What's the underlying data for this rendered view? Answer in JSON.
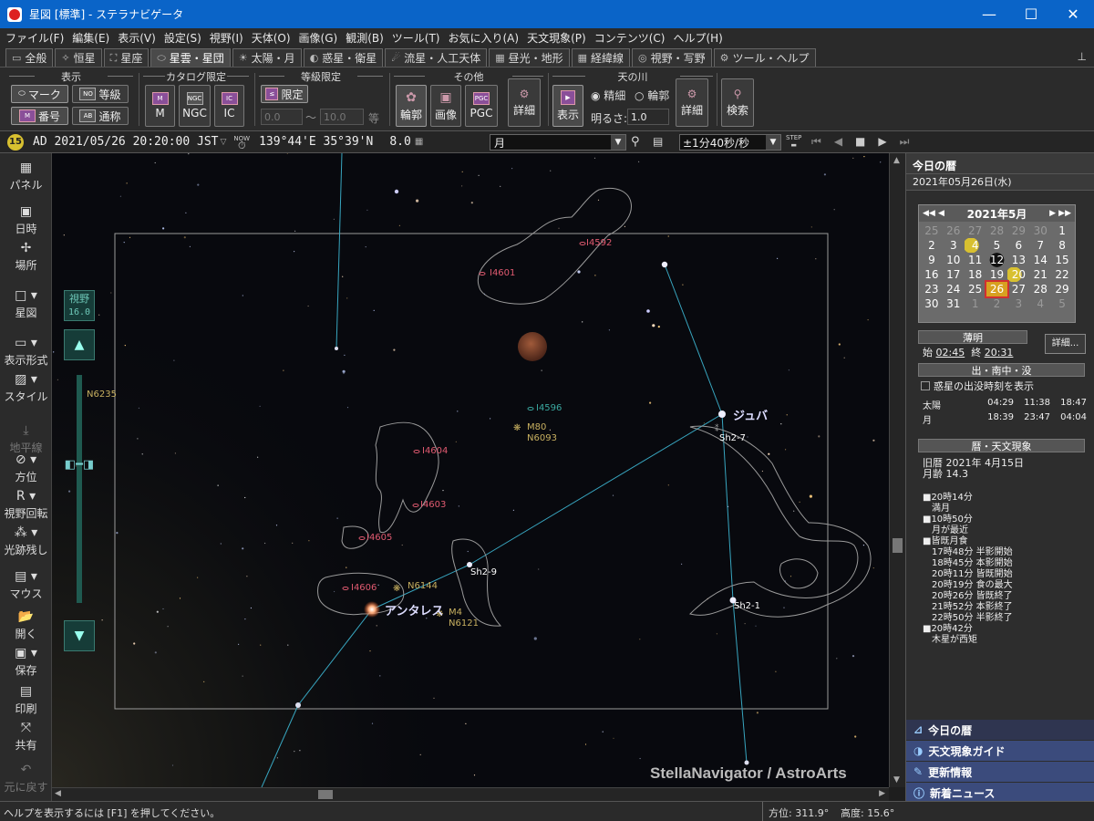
{
  "window": {
    "title": "星図 [標準] - ステラナビゲータ",
    "minimize": "—",
    "maximize": "☐",
    "close": "✕"
  },
  "menu": [
    "ファイル(F)",
    "編集(E)",
    "表示(V)",
    "設定(S)",
    "視野(I)",
    "天体(O)",
    "画像(G)",
    "観測(B)",
    "ツール(T)",
    "お気に入り(A)",
    "天文現象(P)",
    "コンテンツ(C)",
    "ヘルプ(H)"
  ],
  "tabs": [
    {
      "label": "全般",
      "icon": "▭"
    },
    {
      "label": "恒星",
      "icon": "✧"
    },
    {
      "label": "星座",
      "icon": "⛶"
    },
    {
      "label": "星雲・星団",
      "icon": "⬭",
      "active": true
    },
    {
      "label": "太陽・月",
      "icon": "☀"
    },
    {
      "label": "惑星・衛星",
      "icon": "◐"
    },
    {
      "label": "流星・人工天体",
      "icon": "☄"
    },
    {
      "label": "昼光・地形",
      "icon": "▦"
    },
    {
      "label": "経緯線",
      "icon": "▦"
    },
    {
      "label": "視野・写野",
      "icon": "◎"
    },
    {
      "label": "ツール・ヘルプ",
      "icon": "⚙"
    }
  ],
  "ribbon": {
    "display": {
      "title": "表示",
      "mark": "マーク",
      "rank": "等級",
      "number": "番号",
      "common": "通称"
    },
    "catalog": {
      "title": "カタログ限定",
      "m": "M",
      "ngc": "NGC",
      "ic": "IC",
      "m_icon": "M",
      "ngc_icon": "NGC",
      "ic_icon": "IC"
    },
    "mag": {
      "title": "等級限定",
      "limit": "限定",
      "from": "0.0",
      "to": "10.0",
      "sep": "〜",
      "unit": "等"
    },
    "other": {
      "title": "その他",
      "outline": "輪郭",
      "image": "画像",
      "pgc": "PGC",
      "pgc_icon": "PGC",
      "detail": "詳細"
    },
    "milkyway": {
      "title": "天の川",
      "show": "表示",
      "fine": "精細",
      "contour": "輪郭",
      "brightness_label": "明るさ:",
      "brightness": "1.0",
      "detail": "詳細"
    },
    "search": "検索"
  },
  "status": {
    "moon_age_badge": "15",
    "datetime": "AD 2021/05/26 20:20:00 JST",
    "now": "NOW",
    "location": "139°44'E 35°39'N",
    "zoom": "8.0",
    "target": "月",
    "step": "±1分40秒/秒",
    "step_label": "STEP"
  },
  "left_tools": [
    {
      "label": "パネル",
      "icon": "▦"
    },
    {
      "label": "日時",
      "icon": "▣"
    },
    {
      "label": "場所",
      "icon": "✢"
    },
    {
      "label": "星図",
      "icon": "□ ▾"
    },
    {
      "label": "表示形式",
      "icon": "▭ ▾"
    },
    {
      "label": "スタイル",
      "icon": "▨ ▾"
    },
    {
      "label": "地平線",
      "icon": "⤓"
    },
    {
      "label": "方位",
      "icon": "⊘ ▾"
    },
    {
      "label": "視野回転",
      "icon": "R ▾"
    },
    {
      "label": "光跡残し",
      "icon": "⁂ ▾"
    },
    {
      "label": "マウス",
      "icon": "▤ ▾"
    },
    {
      "label": "開く",
      "icon": "📂"
    },
    {
      "label": "保存",
      "icon": "▣ ▾"
    },
    {
      "label": "印刷",
      "icon": "▤"
    },
    {
      "label": "共有",
      "icon": "⤧"
    },
    {
      "label": "元に戻す",
      "icon": "↶"
    }
  ],
  "fov": {
    "label": "視野",
    "value": "16.0",
    "up": "▲",
    "down": "▼"
  },
  "sky": {
    "objects": [
      {
        "id": "jupiter",
        "name": "ジュバ",
        "code": "Sh2-7"
      },
      {
        "id": "antares",
        "name": "アンタレス"
      },
      {
        "id": "m80",
        "name": "M80",
        "code": "N6093"
      },
      {
        "id": "m4",
        "name": "M4",
        "code": "N6121"
      },
      {
        "id": "n6144",
        "name": "N6144"
      },
      {
        "id": "i4596",
        "name": "I4596"
      },
      {
        "id": "i4592",
        "name": "I4592"
      },
      {
        "id": "i4601",
        "name": "I4601"
      },
      {
        "id": "i4604",
        "name": "I4604"
      },
      {
        "id": "i4603",
        "name": "I4603"
      },
      {
        "id": "i4605",
        "name": "I4605"
      },
      {
        "id": "i4606",
        "name": "I4606"
      },
      {
        "id": "sh29",
        "name": "Sh2-9"
      },
      {
        "id": "sh21",
        "name": "Sh2-1"
      },
      {
        "id": "n6235",
        "name": "N6235"
      }
    ],
    "watermark": "StellaNavigator / AstroArts"
  },
  "right": {
    "header": "今日の暦",
    "date": "2021年05月26日(水)",
    "calendar": {
      "title": "2021年5月",
      "prev": "◀◀ ◀",
      "next": "▶ ▶▶",
      "days": [
        [
          "25",
          "o"
        ],
        [
          "26",
          "o"
        ],
        [
          "27",
          "o"
        ],
        [
          "28",
          "o"
        ],
        [
          "29",
          "o"
        ],
        [
          "30",
          "o"
        ],
        [
          "1",
          ""
        ],
        [
          "2",
          ""
        ],
        [
          "3",
          ""
        ],
        [
          "4",
          "q"
        ],
        [
          "5",
          ""
        ],
        [
          "6",
          ""
        ],
        [
          "7",
          ""
        ],
        [
          "8",
          ""
        ],
        [
          "9",
          ""
        ],
        [
          "10",
          ""
        ],
        [
          "11",
          ""
        ],
        [
          "12",
          "n"
        ],
        [
          "13",
          ""
        ],
        [
          "14",
          ""
        ],
        [
          "15",
          ""
        ],
        [
          "16",
          ""
        ],
        [
          "17",
          ""
        ],
        [
          "18",
          ""
        ],
        [
          "19",
          ""
        ],
        [
          "20",
          "q"
        ],
        [
          "21",
          ""
        ],
        [
          "22",
          ""
        ],
        [
          "23",
          ""
        ],
        [
          "24",
          ""
        ],
        [
          "25",
          ""
        ],
        [
          "26",
          "f"
        ],
        [
          "27",
          ""
        ],
        [
          "28",
          ""
        ],
        [
          "29",
          ""
        ],
        [
          "30",
          ""
        ],
        [
          "31",
          ""
        ],
        [
          "1",
          "o"
        ],
        [
          "2",
          "o"
        ],
        [
          "3",
          "o"
        ],
        [
          "4",
          "o"
        ],
        [
          "5",
          "o"
        ]
      ]
    },
    "twilight": {
      "title": "薄明",
      "start_label": "始",
      "start": "02:45",
      "end_label": "終",
      "end": "20:31",
      "detail": "詳細..."
    },
    "rise": {
      "title": "出・南中・没",
      "checkbox": "惑星の出没時刻を表示",
      "rows": [
        [
          "太陽",
          "04:29",
          "11:38",
          "18:47"
        ],
        [
          "月",
          "18:39",
          "23:47",
          "04:04"
        ]
      ]
    },
    "events": {
      "title": "暦・天文現象",
      "line1": "旧暦 2021年 4月15日",
      "line2": "月齢 14.3",
      "items": [
        "■20時14分",
        "満月",
        "■10時50分",
        "月が最近",
        "■皆既月食",
        "17時48分 半影開始",
        "18時45分 本影開始",
        "20時11分 皆既開始",
        "20時19分 食の最大",
        "20時26分 皆既終了",
        "21時52分 本影終了",
        "22時50分 半影終了",
        "■20時42分",
        "木星が西矩"
      ]
    },
    "links": [
      "今日の暦",
      "天文現象ガイド",
      "更新情報",
      "新着ニュース"
    ]
  },
  "statusbar": {
    "help": "ヘルプを表示するには [F1] を押してください。",
    "azimuth": "方位: 311.9°",
    "altitude": "高度: 15.6°"
  }
}
